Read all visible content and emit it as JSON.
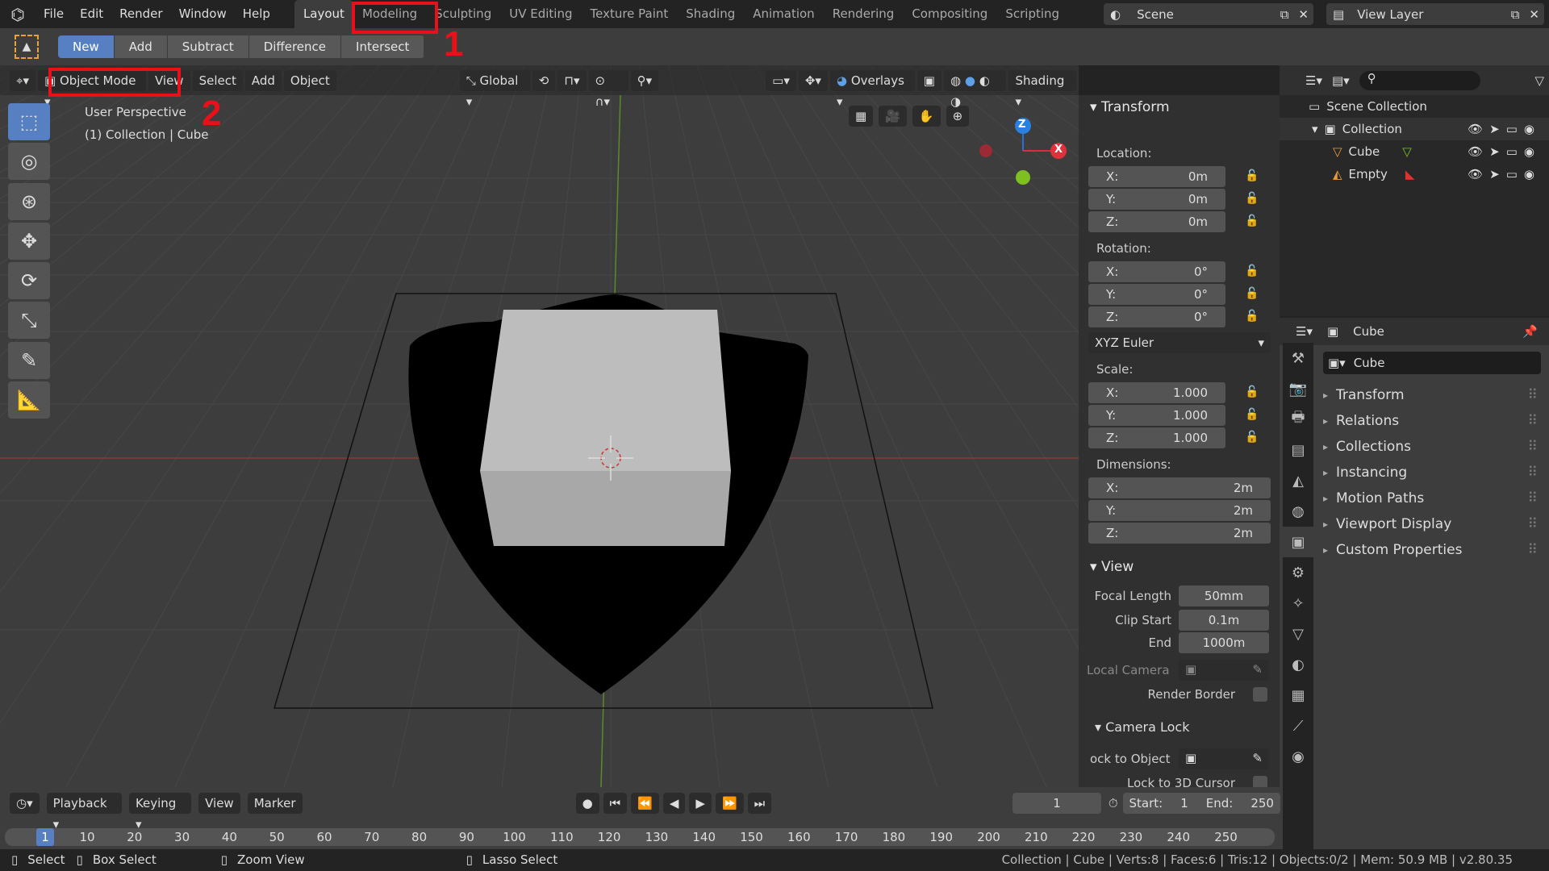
{
  "menu": [
    "File",
    "Edit",
    "Render",
    "Window",
    "Help"
  ],
  "workspaces": [
    "Layout",
    "Modeling",
    "Sculpting",
    "UV Editing",
    "Texture Paint",
    "Shading",
    "Animation",
    "Rendering",
    "Compositing",
    "Scripting"
  ],
  "active_workspace": "Layout",
  "scene": "Scene",
  "view_layer": "View Layer",
  "tool_modes": [
    "New",
    "Add",
    "Subtract",
    "Difference",
    "Intersect"
  ],
  "annotations": [
    "1",
    "2"
  ],
  "viewport_header": {
    "mode": "Object Mode",
    "menus": [
      "View",
      "Select",
      "Add",
      "Object"
    ],
    "orientation": "Global",
    "overlays": "Overlays",
    "shading": "Shading"
  },
  "viewport": {
    "perspective": "User Perspective",
    "collection": "(1) Collection | Cube",
    "axis_x": "X",
    "axis_z": "Z"
  },
  "transform": {
    "title": "Transform",
    "location_label": "Location:",
    "location": [
      [
        "X:",
        "0m"
      ],
      [
        "Y:",
        "0m"
      ],
      [
        "Z:",
        "0m"
      ]
    ],
    "rotation_label": "Rotation:",
    "rotation": [
      [
        "X:",
        "0°"
      ],
      [
        "Y:",
        "0°"
      ],
      [
        "Z:",
        "0°"
      ]
    ],
    "rotation_mode": "XYZ Euler",
    "scale_label": "Scale:",
    "scale": [
      [
        "X:",
        "1.000"
      ],
      [
        "Y:",
        "1.000"
      ],
      [
        "Z:",
        "1.000"
      ]
    ],
    "dimensions_label": "Dimensions:",
    "dimensions": [
      [
        "X:",
        "2m"
      ],
      [
        "Y:",
        "2m"
      ],
      [
        "Z:",
        "2m"
      ]
    ]
  },
  "view": {
    "title": "View",
    "focal_length_label": "Focal Length",
    "focal_length": "50mm",
    "clip_start_label": "Clip Start",
    "clip_start": "0.1m",
    "end_label": "End",
    "end": "1000m",
    "local_camera": "Local Camera",
    "render_border": "Render Border",
    "camera_lock": "Camera Lock",
    "lock_object": "ock to Object",
    "lock_cursor": "Lock to 3D Cursor"
  },
  "outliner": {
    "scene_collection": "Scene Collection",
    "collection": "Collection",
    "items": [
      "Cube",
      "Empty"
    ]
  },
  "properties": {
    "object": "Cube",
    "name_field": "Cube",
    "sections": [
      "Transform",
      "Relations",
      "Collections",
      "Instancing",
      "Motion Paths",
      "Viewport Display",
      "Custom Properties"
    ]
  },
  "timeline": {
    "menus": [
      "Playback",
      "Keying",
      "View",
      "Marker"
    ],
    "current_frame": "1",
    "start_label": "Start:",
    "start": "1",
    "end_label": "End:",
    "end": "250",
    "ticks": [
      "10",
      "20",
      "30",
      "40",
      "50",
      "60",
      "70",
      "80",
      "90",
      "100",
      "110",
      "120",
      "130",
      "140",
      "150",
      "160",
      "170",
      "180",
      "190",
      "200",
      "210",
      "220",
      "230",
      "240",
      "250"
    ]
  },
  "status": {
    "select": "Select",
    "box_select": "Box Select",
    "zoom_view": "Zoom View",
    "lasso_select": "Lasso Select",
    "info": "Collection | Cube | Verts:8 | Faces:6 | Tris:12 | Objects:0/2 | Mem: 50.9 MB | v2.80.35"
  }
}
